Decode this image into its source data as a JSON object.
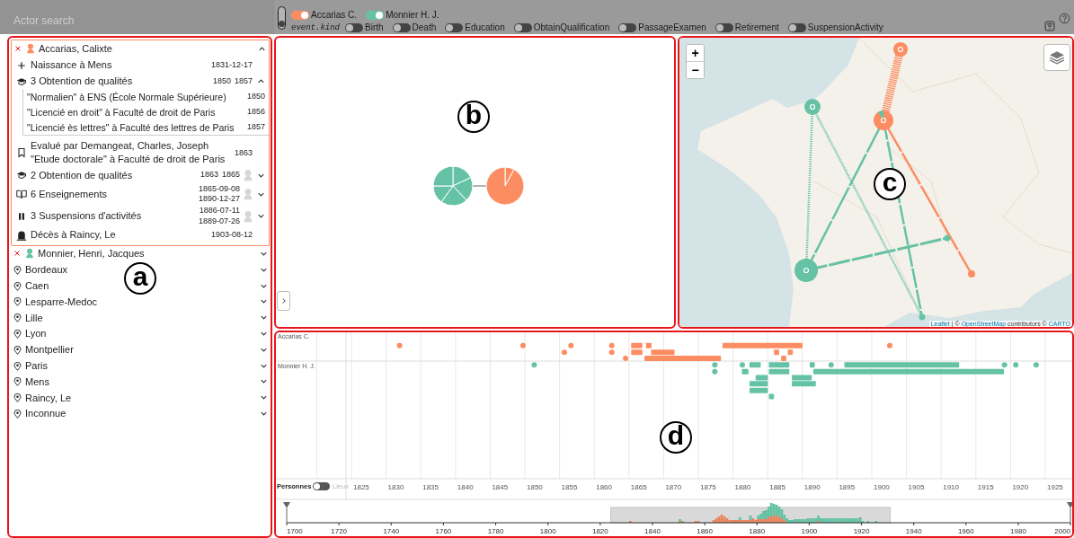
{
  "search": {
    "placeholder": "Actor search"
  },
  "mode_switch": {
    "on": false
  },
  "person_filters": [
    {
      "label": "Accarias C.",
      "color": "#fc8d62",
      "on": true
    },
    {
      "label": "Monnier H. J.",
      "color": "#66c2a5",
      "on": true
    }
  ],
  "kind_filter": {
    "label": "event.kind",
    "options": [
      {
        "label": "Birth",
        "on": false
      },
      {
        "label": "Death",
        "on": false
      },
      {
        "label": "Education",
        "on": false
      },
      {
        "label": "ObtainQualification",
        "on": false
      },
      {
        "label": "PassageExamen",
        "on": false
      },
      {
        "label": "Retirement",
        "on": false
      },
      {
        "label": "SuspensionActivity",
        "on": false
      }
    ]
  },
  "actors": [
    {
      "kind": "person",
      "name": "Accarias, Calixte",
      "color": "#fc8d62",
      "expanded": true,
      "events": [
        {
          "kind": "birth",
          "label": "Naissance à Mens",
          "dates": [
            "1831-12-17"
          ]
        },
        {
          "kind": "qualification",
          "label": "3 Obtention de qualités",
          "dates": [
            "1850",
            "1857"
          ],
          "expanded": true,
          "children": [
            {
              "label": "\"Normalien\" à ENS (École Normale Supérieure)",
              "date": "1850"
            },
            {
              "label": "\"Licencié en droit\" à Faculté de droit de Paris",
              "date": "1856"
            },
            {
              "label": "\"Licencié ès lettres\" à Faculté des lettres de Paris",
              "date": "1857"
            }
          ]
        },
        {
          "kind": "evaluation",
          "label": "Evalué par Demangeat, Charles, Joseph \"Etude doctorale\" à Faculté de droit de Paris",
          "dates": [
            "1863"
          ]
        },
        {
          "kind": "qualification",
          "label": "2 Obtention de qualités",
          "dates": [
            "1863",
            "1865"
          ],
          "expanded": false
        },
        {
          "kind": "teaching",
          "label": "6 Enseignements",
          "dates": [
            "1865-09-08",
            "1890-12-27"
          ],
          "expanded": false
        },
        {
          "kind": "suspension",
          "label": "3 Suspensions d'activités",
          "dates": [
            "1886-07-11",
            "1889-07-26"
          ],
          "expanded": false
        },
        {
          "kind": "death",
          "label": "Décès à Raincy, Le",
          "dates": [
            "1903-08-12"
          ]
        }
      ]
    },
    {
      "kind": "person",
      "name": "Monnier, Henri, Jacques",
      "color": "#66c2a5",
      "expanded": false
    },
    {
      "kind": "place",
      "name": "Bordeaux",
      "expanded": false
    },
    {
      "kind": "place",
      "name": "Caen",
      "expanded": false
    },
    {
      "kind": "place",
      "name": "Lesparre-Medoc",
      "expanded": false
    },
    {
      "kind": "place",
      "name": "Lille",
      "expanded": false
    },
    {
      "kind": "place",
      "name": "Lyon",
      "expanded": false
    },
    {
      "kind": "place",
      "name": "Montpellier",
      "expanded": false
    },
    {
      "kind": "place",
      "name": "Paris",
      "expanded": false
    },
    {
      "kind": "place",
      "name": "Mens",
      "expanded": false
    },
    {
      "kind": "place",
      "name": "Raincy, Le",
      "expanded": false
    },
    {
      "kind": "place",
      "name": "Inconnue",
      "expanded": false
    }
  ],
  "actor_panel": {
    "annotation": "a"
  },
  "network_panel": {
    "annotation": "b"
  },
  "map_panel": {
    "annotation": "c",
    "zoom_in": "+",
    "zoom_out": "−",
    "attribution": [
      {
        "text": "Leaflet",
        "link": true
      },
      {
        "text": "| ©",
        "link": false
      },
      {
        "text": "OpenStreetMap",
        "link": true
      },
      {
        "text": "contributors ©",
        "link": false
      },
      {
        "text": "CARTO",
        "link": true
      }
    ]
  },
  "timeline_panel": {
    "annotation": "d",
    "rows": [
      {
        "label": "Accarias C.",
        "color": "#fc8d62"
      },
      {
        "label": "Monnier H. J.",
        "color": "#66c2a5"
      }
    ],
    "ticks": [
      "1825",
      "1830",
      "1835",
      "1840",
      "1845",
      "1850",
      "1855",
      "1860",
      "1865",
      "1870",
      "1875",
      "1880",
      "1885",
      "1890",
      "1895",
      "1900",
      "1905",
      "1910",
      "1915",
      "1920",
      "1925"
    ],
    "view_switch": {
      "left": "Personnes",
      "right": "Lieux",
      "on": false
    },
    "brush_ticks": [
      "1700",
      "1720",
      "1740",
      "1760",
      "1780",
      "1800",
      "1820",
      "1840",
      "1860",
      "1880",
      "1900",
      "1920",
      "1940",
      "1960",
      "1980",
      "2000"
    ]
  }
}
